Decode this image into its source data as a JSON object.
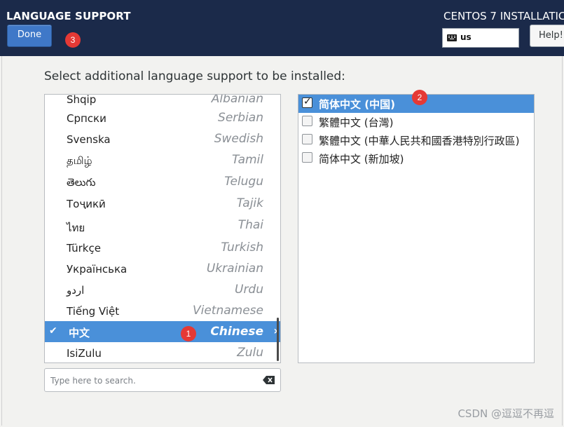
{
  "header": {
    "title": "LANGUAGE SUPPORT",
    "done_label": "Done",
    "product_title": "CENTOS 7 INSTALLATIC",
    "keyboard_layout": "us",
    "help_label": "Help!"
  },
  "prompt": "Select additional language support to be installed:",
  "languages": [
    {
      "native": "Shqip",
      "english": "Albanian"
    },
    {
      "native": "Српски",
      "english": "Serbian"
    },
    {
      "native": "Svenska",
      "english": "Swedish"
    },
    {
      "native": "தமிழ்",
      "english": "Tamil"
    },
    {
      "native": "తెలుగు",
      "english": "Telugu"
    },
    {
      "native": "Тоҷикӣ",
      "english": "Tajik"
    },
    {
      "native": "ไทย",
      "english": "Thai"
    },
    {
      "native": "Türkçe",
      "english": "Turkish"
    },
    {
      "native": "Українська",
      "english": "Ukrainian"
    },
    {
      "native": "اردو",
      "english": "Urdu"
    },
    {
      "native": "Tiếng Việt",
      "english": "Vietnamese"
    },
    {
      "native": "中文",
      "english": "Chinese",
      "selected": true
    },
    {
      "native": "IsiZulu",
      "english": "Zulu"
    }
  ],
  "search": {
    "placeholder": "Type here to search."
  },
  "locales": [
    {
      "label": "简体中文 (中国)",
      "checked": true
    },
    {
      "label": "繁體中文 (台灣)",
      "checked": false
    },
    {
      "label": "繁體中文 (中華人民共和國香港特別行政區)",
      "checked": false
    },
    {
      "label": "简体中文 (新加坡)",
      "checked": false
    }
  ],
  "annotations": {
    "badge1": "1",
    "badge2": "2",
    "badge3": "3"
  },
  "watermark": "CSDN @逗逗不再逗",
  "colors": {
    "header_bg": "#1b2a4a",
    "selection": "#4a90d9",
    "done_button": "#3f78c8",
    "badge_red": "#e53935"
  }
}
